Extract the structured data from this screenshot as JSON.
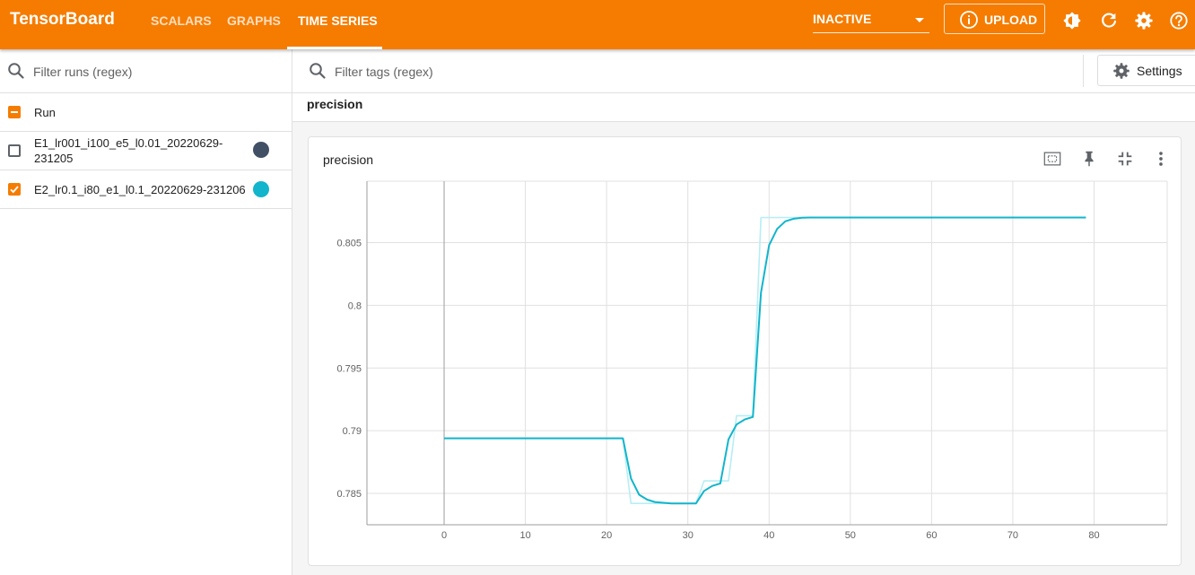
{
  "header": {
    "brand": "TensorBoard",
    "tabs": [
      {
        "label": "SCALARS",
        "active": false
      },
      {
        "label": "GRAPHS",
        "active": false
      },
      {
        "label": "TIME SERIES",
        "active": true
      }
    ],
    "reload_state": "INACTIVE",
    "upload_label": "UPLOAD",
    "icons": [
      "theme-toggle-icon",
      "refresh-icon",
      "settings-gear-icon",
      "help-icon"
    ],
    "bar_color": "#f57c00"
  },
  "sidebar": {
    "filter_placeholder": "Filter runs (regex)",
    "run_header_label": "Run",
    "runs": [
      {
        "name": "E1_lr001_i100_e5_l0.01_20220629-231205",
        "line1": "E1_lr001_i100_e5_l0.01_20220629-",
        "line2": "231205",
        "checked": false,
        "color": "#425066"
      },
      {
        "name": "E2_lr0.1_i80_e1_l0.1_20220629-231206",
        "line1": "E2_lr0.1_i80_e1_l0.1_20220629-231206",
        "line2": "",
        "checked": true,
        "color": "#12b5cb"
      }
    ]
  },
  "main": {
    "tag_filter_placeholder": "Filter tags (regex)",
    "settings_label": "Settings",
    "group_name": "precision",
    "card_title": "precision"
  },
  "chart_data": {
    "type": "line",
    "title": "precision",
    "xlabel": "",
    "ylabel": "",
    "xlim": [
      -9.5,
      89
    ],
    "ylim": [
      0.7825,
      0.8099
    ],
    "x_ticks": [
      0,
      10,
      20,
      30,
      40,
      50,
      60,
      70,
      80
    ],
    "y_ticks": [
      0.785,
      0.79,
      0.795,
      0.8,
      0.805
    ],
    "y_tick_labels": [
      "0.785",
      "0.79",
      "0.795",
      "0.8",
      "0.805"
    ],
    "grid": true,
    "series": [
      {
        "name": "E2_lr0.1_i80_e1_l0.1_20220629-231206",
        "style": "raw",
        "color": "#b6eef4",
        "x": [
          0,
          22,
          23,
          31,
          32,
          35,
          36,
          38,
          39,
          43,
          79
        ],
        "y": [
          0.7894,
          0.7894,
          0.7842,
          0.7842,
          0.786,
          0.786,
          0.7912,
          0.7912,
          0.807,
          0.807,
          0.807
        ]
      },
      {
        "name": "E2_lr0.1_i80_e1_l0.1_20220629-231206",
        "style": "smoothed",
        "color": "#12b5cb",
        "x": [
          0,
          22,
          23,
          24,
          25,
          26,
          27,
          28,
          29,
          30,
          31,
          32,
          33,
          34,
          35,
          36,
          37,
          38,
          39,
          40,
          41,
          42,
          43,
          44,
          45,
          79
        ],
        "y": [
          0.7894,
          0.7894,
          0.7862,
          0.7849,
          0.7845,
          0.7843,
          0.78425,
          0.7842,
          0.7842,
          0.7842,
          0.7842,
          0.7852,
          0.7856,
          0.7858,
          0.7893,
          0.7905,
          0.7909,
          0.7911,
          0.801,
          0.8048,
          0.8061,
          0.8067,
          0.8069,
          0.80698,
          0.807,
          0.807
        ]
      }
    ]
  }
}
